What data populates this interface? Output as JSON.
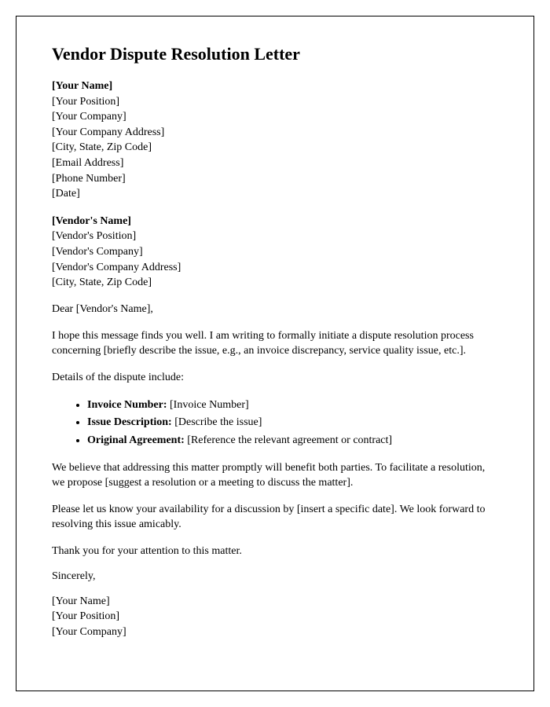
{
  "title": "Vendor Dispute Resolution Letter",
  "sender": {
    "name": "[Your Name]",
    "position": "[Your Position]",
    "company": "[Your Company]",
    "address": "[Your Company Address]",
    "city_state_zip": "[City, State, Zip Code]",
    "email": "[Email Address]",
    "phone": "[Phone Number]",
    "date": "[Date]"
  },
  "recipient": {
    "name": "[Vendor's Name]",
    "position": "[Vendor's Position]",
    "company": "[Vendor's Company]",
    "address": "[Vendor's Company Address]",
    "city_state_zip": "[City, State, Zip Code]"
  },
  "salutation": "Dear [Vendor's Name],",
  "paragraphs": {
    "intro": "I hope this message finds you well. I am writing to formally initiate a dispute resolution process concerning [briefly describe the issue, e.g., an invoice discrepancy, service quality issue, etc.].",
    "details_lead": "Details of the dispute include:",
    "resolution": "We believe that addressing this matter promptly will benefit both parties. To facilitate a resolution, we propose [suggest a resolution or a meeting to discuss the matter].",
    "availability": "Please let us know your availability for a discussion by [insert a specific date]. We look forward to resolving this issue amicably.",
    "thanks": "Thank you for your attention to this matter."
  },
  "details": {
    "invoice_label": "Invoice Number:",
    "invoice_value": " [Invoice Number]",
    "issue_label": "Issue Description:",
    "issue_value": " [Describe the issue]",
    "agreement_label": "Original Agreement:",
    "agreement_value": " [Reference the relevant agreement or contract]"
  },
  "closing": "Sincerely,",
  "signature": {
    "name": "[Your Name]",
    "position": "[Your Position]",
    "company": "[Your Company]"
  }
}
